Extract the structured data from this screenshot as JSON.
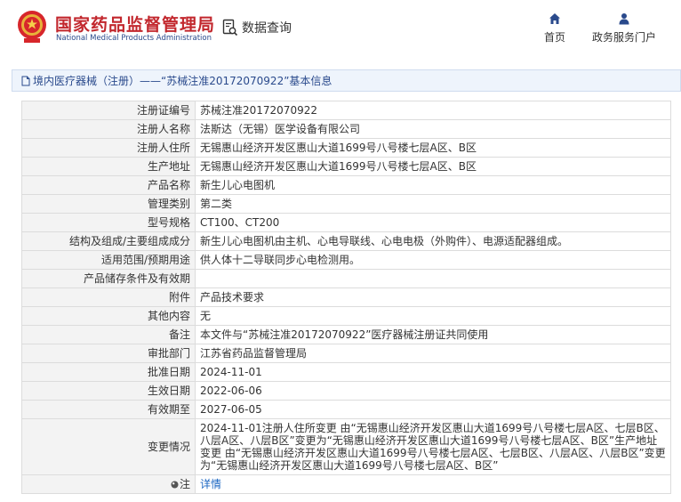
{
  "header": {
    "title_cn": "国家药品监督管理局",
    "title_en": "National Medical Products Administration",
    "query_label": "数据查询",
    "nav": [
      {
        "label": "首页",
        "icon": "home-icon"
      },
      {
        "label": "政务服务门户",
        "icon": "user-icon"
      }
    ]
  },
  "breadcrumb": {
    "text": "境内医疗器械（注册）——“苏械注准20172070922”基本信息"
  },
  "record": {
    "rows": [
      {
        "label": "注册证编号",
        "value": "苏械注准20172070922"
      },
      {
        "label": "注册人名称",
        "value": "法斯达（无锡）医学设备有限公司"
      },
      {
        "label": "注册人住所",
        "value": "无锡惠山经济开发区惠山大道1699号八号楼七层A区、B区"
      },
      {
        "label": "生产地址",
        "value": "无锡惠山经济开发区惠山大道1699号八号楼七层A区、B区"
      },
      {
        "label": "产品名称",
        "value": "新生儿心电图机"
      },
      {
        "label": "管理类别",
        "value": "第二类"
      },
      {
        "label": "型号规格",
        "value": "CT100、CT200"
      },
      {
        "label": "结构及组成/主要组成成分",
        "value": "新生儿心电图机由主机、心电导联线、心电电极（外购件）、电源适配器组成。"
      },
      {
        "label": "适用范围/预期用途",
        "value": "供人体十二导联同步心电检测用。"
      },
      {
        "label": "产品储存条件及有效期",
        "value": ""
      },
      {
        "label": "附件",
        "value": "产品技术要求"
      },
      {
        "label": "其他内容",
        "value": "无"
      },
      {
        "label": "备注",
        "value": "本文件与“苏械注准20172070922”医疗器械注册证共同使用"
      },
      {
        "label": "审批部门",
        "value": "江苏省药品监督管理局"
      },
      {
        "label": "批准日期",
        "value": "2024-11-01"
      },
      {
        "label": "生效日期",
        "value": "2022-06-06"
      },
      {
        "label": "有效期至",
        "value": "2027-06-05"
      },
      {
        "label": "变更情况",
        "value": "2024-11-01注册人住所变更 由“无锡惠山经济开发区惠山大道1699号八号楼七层A区、七层B区、八层A区、八层B区”变更为“无锡惠山经济开发区惠山大道1699号八号楼七层A区、B区”生产地址变更 由“无锡惠山经济开发区惠山大道1699号八号楼七层A区、七层B区、八层A区、八层B区”变更为“无锡惠山经济开发区惠山大道1699号八号楼七层A区、B区”"
      }
    ],
    "note_label": "注",
    "note_link": "详情"
  },
  "colors": {
    "brand_red": "#c2272d",
    "link_blue": "#1a66c2",
    "nav_blue": "#2a4a8c"
  }
}
